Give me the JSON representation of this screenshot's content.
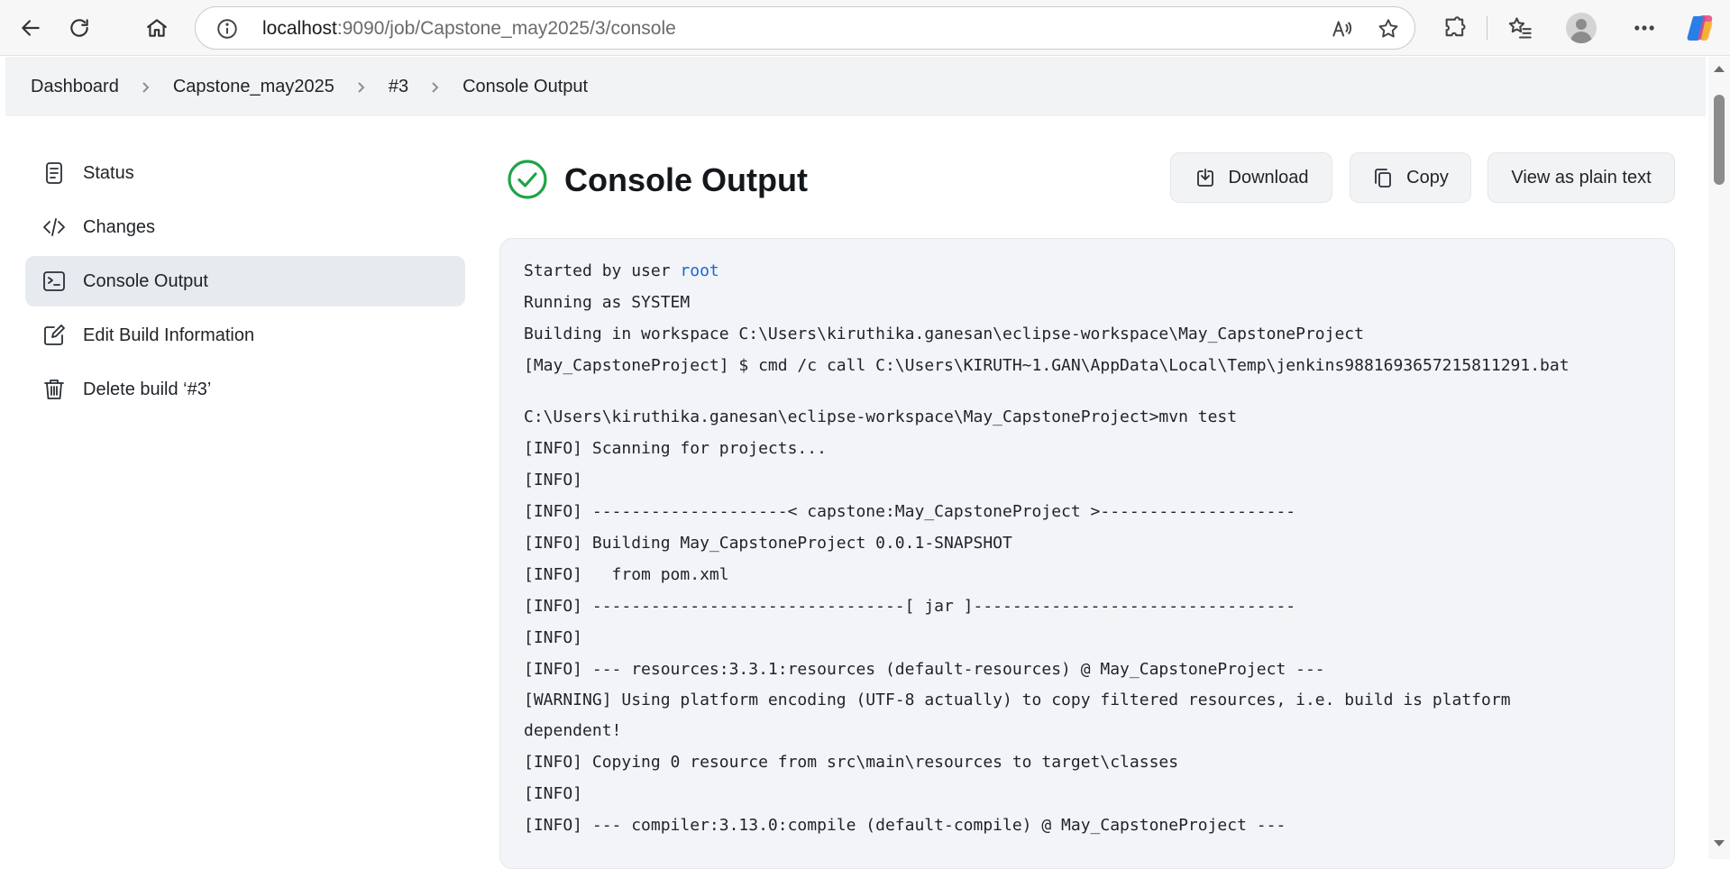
{
  "browser": {
    "url_host": "localhost",
    "url_path": ":9090/job/Capstone_may2025/3/console",
    "icons": [
      "back-icon",
      "refresh-icon",
      "home-icon",
      "info-icon",
      "read-aloud-icon",
      "favorite-star-icon",
      "extensions-icon",
      "favorites-icon",
      "profile-avatar",
      "more-icon",
      "copilot-icon"
    ]
  },
  "breadcrumb": {
    "items": [
      "Dashboard",
      "Capstone_may2025",
      "#3",
      "Console Output"
    ]
  },
  "sidebar": {
    "items": [
      {
        "label": "Status",
        "icon": "document-icon"
      },
      {
        "label": "Changes",
        "icon": "code-icon"
      },
      {
        "label": "Console Output",
        "icon": "terminal-icon",
        "active": true
      },
      {
        "label": "Edit Build Information",
        "icon": "edit-icon"
      },
      {
        "label": "Delete build ‘#3’",
        "icon": "trash-icon"
      }
    ]
  },
  "main": {
    "title": "Console Output",
    "status": "success",
    "status_color": "#1ea446",
    "actions": {
      "download": "Download",
      "copy": "Copy",
      "plain": "View as plain text"
    }
  },
  "console": {
    "started_prefix": "Started by user ",
    "started_user": "root",
    "lines": [
      "Running as SYSTEM",
      "Building in workspace C:\\Users\\kiruthika.ganesan\\eclipse-workspace\\May_CapstoneProject",
      "[May_CapstoneProject] $ cmd /c call C:\\Users\\KIRUTH~1.GAN\\AppData\\Local\\Temp\\jenkins9881693657215811291.bat",
      "",
      "C:\\Users\\kiruthika.ganesan\\eclipse-workspace\\May_CapstoneProject>mvn test",
      "[INFO] Scanning for projects...",
      "[INFO]",
      "[INFO] --------------------< capstone:May_CapstoneProject >--------------------",
      "[INFO] Building May_CapstoneProject 0.0.1-SNAPSHOT",
      "[INFO]   from pom.xml",
      "[INFO] --------------------------------[ jar ]---------------------------------",
      "[INFO]",
      "[INFO] --- resources:3.3.1:resources (default-resources) @ May_CapstoneProject ---",
      "[WARNING] Using platform encoding (UTF-8 actually) to copy filtered resources, i.e. build is platform dependent!",
      "[INFO] Copying 0 resource from src\\main\\resources to target\\classes",
      "[INFO]",
      "[INFO] --- compiler:3.13.0:compile (default-compile) @ May_CapstoneProject ---"
    ]
  },
  "colors": {
    "accent_link": "#1a66d9",
    "console_bg": "#f2f4f7",
    "sidebar_active_bg": "#e7eaef"
  }
}
